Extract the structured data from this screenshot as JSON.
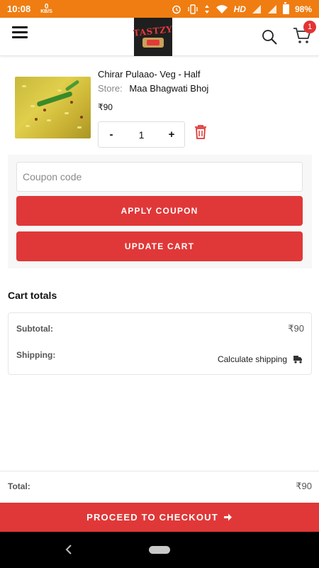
{
  "status_bar": {
    "time": "10:08",
    "net_speed_value": "0",
    "net_speed_unit": "KB/S",
    "network_label": "HD",
    "battery": "98%"
  },
  "header": {
    "logo_text": "TASTZY",
    "cart_count": "1"
  },
  "cart_item": {
    "name": "Chirar Pulaao- Veg - Half",
    "store_label": "Store:",
    "store_name": "Maa Bhagwati Bhoj",
    "price": "₹90",
    "quantity": "1",
    "minus_label": "-",
    "plus_label": "+"
  },
  "coupon": {
    "placeholder": "Coupon code",
    "apply_label": "APPLY COUPON",
    "update_label": "UPDATE CART"
  },
  "cart_totals": {
    "title": "Cart totals",
    "subtotal_label": "Subtotal:",
    "subtotal_value": "₹90",
    "shipping_label": "Shipping:",
    "shipping_link": "Calculate shipping"
  },
  "footer": {
    "total_label": "Total:",
    "total_value": "₹90",
    "checkout_label": "PROCEED TO CHECKOUT"
  },
  "colors": {
    "status_bar": "#ef7d12",
    "accent_red": "#e03838",
    "badge_red": "#e33434"
  },
  "icons": [
    "menu-icon",
    "search-icon",
    "cart-icon",
    "trash-icon",
    "truck-icon",
    "arrow-right-icon",
    "nav-back-icon"
  ]
}
